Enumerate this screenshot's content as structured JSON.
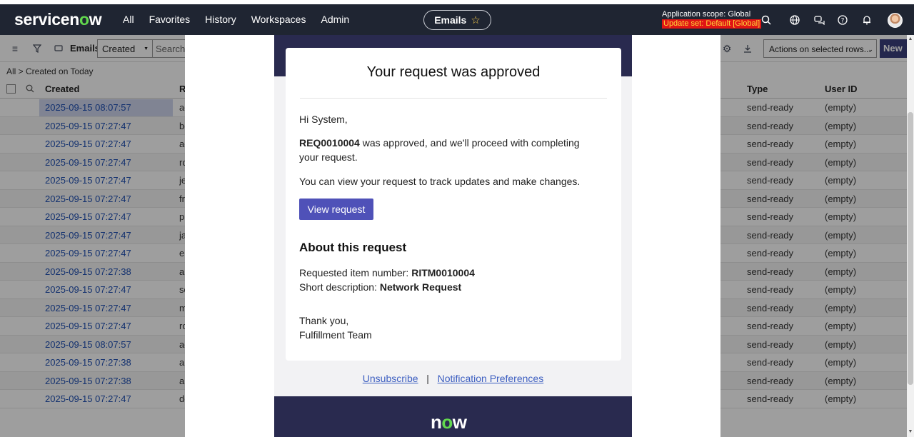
{
  "topnav": {
    "logo_text": "servicenow",
    "links": [
      "All",
      "Favorites",
      "History",
      "Workspaces",
      "Admin"
    ],
    "context_pill": "Emails",
    "scope_label": "Application scope: Global",
    "update_set": "Update set: Default [Global]"
  },
  "list": {
    "title": "Emails",
    "search_field": "Created",
    "search_placeholder": "Search",
    "actions_label": "Actions on selected rows...",
    "new_label": "New",
    "breadcrumb": "All > Created on Today",
    "columns": {
      "created": "Created",
      "r": "R",
      "type": "Type",
      "user": "User ID"
    },
    "rows": [
      {
        "created": "2025-09-15 08:07:57",
        "r": "ad",
        "type": "send-ready",
        "user": "(empty)"
      },
      {
        "created": "2025-09-15 07:27:47",
        "r": "be",
        "type": "send-ready",
        "user": "(empty)"
      },
      {
        "created": "2025-09-15 07:27:47",
        "r": "ad",
        "type": "send-ready",
        "user": "(empty)"
      },
      {
        "created": "2025-09-15 07:27:47",
        "r": "ro",
        "type": "send-ready",
        "user": "(empty)"
      },
      {
        "created": "2025-09-15 07:27:47",
        "r": "je",
        "type": "send-ready",
        "user": "(empty)"
      },
      {
        "created": "2025-09-15 07:27:47",
        "r": "fr",
        "type": "send-ready",
        "user": "(empty)"
      },
      {
        "created": "2025-09-15 07:27:47",
        "r": "pu",
        "type": "send-ready",
        "user": "(empty)"
      },
      {
        "created": "2025-09-15 07:27:47",
        "r": "ja",
        "type": "send-ready",
        "user": "(empty)"
      },
      {
        "created": "2025-09-15 07:27:47",
        "r": "ei",
        "type": "send-ready",
        "user": "(empty)"
      },
      {
        "created": "2025-09-15 07:27:38",
        "r": "ai",
        "type": "send-ready",
        "user": "(empty)"
      },
      {
        "created": "2025-09-15 07:27:47",
        "r": "sc",
        "type": "send-ready",
        "user": "(empty)"
      },
      {
        "created": "2025-09-15 07:27:47",
        "r": "m",
        "type": "send-ready",
        "user": "(empty)"
      },
      {
        "created": "2025-09-15 07:27:47",
        "r": "ro",
        "type": "send-ready",
        "user": "(empty)"
      },
      {
        "created": "2025-09-15 08:07:57",
        "r": "ad",
        "type": "send-ready",
        "user": "(empty)"
      },
      {
        "created": "2025-09-15 07:27:38",
        "r": "ai",
        "type": "send-ready",
        "user": "(empty)"
      },
      {
        "created": "2025-09-15 07:27:38",
        "r": "ai",
        "type": "send-ready",
        "user": "(empty)"
      },
      {
        "created": "2025-09-15 07:27:47",
        "r": "de",
        "type": "send-ready",
        "user": "(empty)"
      }
    ]
  },
  "email": {
    "title": "Your request was approved",
    "greeting": "Hi System,",
    "req_number": "REQ0010004",
    "approved_text": " was approved, and we'll proceed with completing your request.",
    "view_text": "You can view your request to track updates and make changes.",
    "button_label": "View request",
    "about_heading": "About this request",
    "item_label": "Requested item number: ",
    "item_value": "RITM0010004",
    "desc_label": "Short description: ",
    "desc_value": "Network Request",
    "thanks": "Thank you,",
    "team": "Fulfillment Team",
    "unsubscribe": "Unsubscribe",
    "separator": "|",
    "preferences": "Notification Preferences",
    "footer_logo": "now"
  },
  "colors": {
    "nav_bg": "#1f2532",
    "brand_green": "#62d84e",
    "email_banner": "#292a4f",
    "button": "#4f51b8",
    "link": "#1f4fb3"
  }
}
